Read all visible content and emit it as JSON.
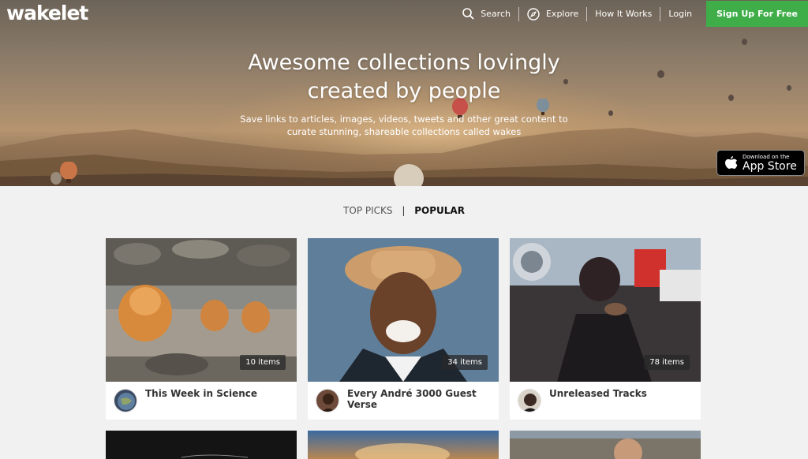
{
  "brand": {
    "logo": "wakelet"
  },
  "nav": {
    "search_label": "Search",
    "explore_label": "Explore",
    "how_label": "How It Works",
    "login_label": "Login",
    "signup_label": "Sign Up For Free"
  },
  "hero": {
    "title_line1": "Awesome collections lovingly",
    "title_line2": "created by people",
    "sub_line1": "Save links to articles, images, videos, tweets and other great content to",
    "sub_line2": "curate stunning, shareable collections called wakes"
  },
  "appstore": {
    "small": "Download on the",
    "big": "App Store"
  },
  "tabs": {
    "top_picks": "TOP PICKS",
    "separator": "|",
    "popular": "POPULAR"
  },
  "cards": [
    {
      "title": "This Week in Science",
      "count": "10 items"
    },
    {
      "title": "Every André 3000 Guest Verse",
      "count": "34 items"
    },
    {
      "title": "Unreleased Tracks",
      "count": "78 items"
    }
  ],
  "colors": {
    "signup": "#3fae49",
    "background": "#f1f1f1"
  }
}
